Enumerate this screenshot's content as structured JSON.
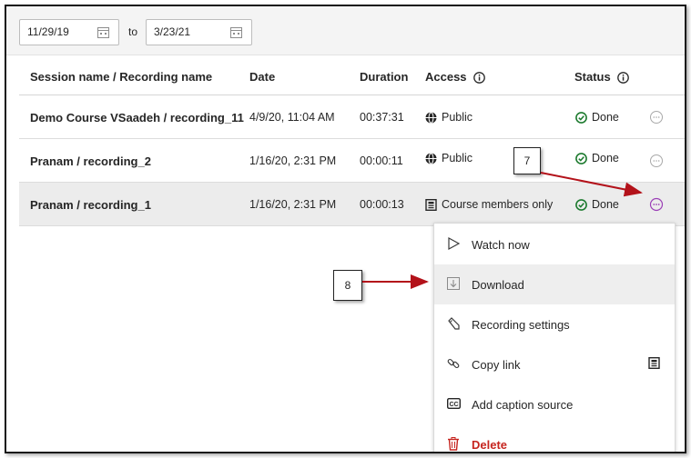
{
  "filter": {
    "start_date": "11/29/19",
    "to_label": "to",
    "end_date": "3/23/21"
  },
  "columns": {
    "name": "Session name / Recording name",
    "date": "Date",
    "duration": "Duration",
    "access": "Access",
    "status": "Status"
  },
  "rows": [
    {
      "name": "Demo Course VSaadeh / recording_11",
      "date": "4/9/20, 11:04 AM",
      "duration": "00:37:31",
      "access": "Public",
      "access_icon": "globe-icon",
      "status": "Done"
    },
    {
      "name": "Pranam / recording_2",
      "date": "1/16/20, 2:31 PM",
      "duration": "00:00:11",
      "access": "Public",
      "access_icon": "globe-icon",
      "status": "Done"
    },
    {
      "name": "Pranam / recording_1",
      "date": "1/16/20, 2:31 PM",
      "duration": "00:00:13",
      "access": "Course members only",
      "access_icon": "course-members-icon",
      "status": "Done"
    }
  ],
  "menu": {
    "items": [
      {
        "label": "Watch now",
        "icon": "play-icon"
      },
      {
        "label": "Download",
        "icon": "download-icon"
      },
      {
        "label": "Recording settings",
        "icon": "pencil-icon"
      },
      {
        "label": "Copy link",
        "icon": "link-icon",
        "tail_icon": "course-members-icon"
      },
      {
        "label": "Add caption source",
        "icon": "closed-caption-icon"
      },
      {
        "label": "Delete",
        "icon": "trash-icon"
      }
    ]
  },
  "callouts": {
    "step7": "7",
    "step8": "8"
  },
  "colors": {
    "done_green": "#1e7b30",
    "active_purple": "#9b3fb6",
    "delete_red": "#c6251f",
    "arrow_red": "#b3121a"
  }
}
